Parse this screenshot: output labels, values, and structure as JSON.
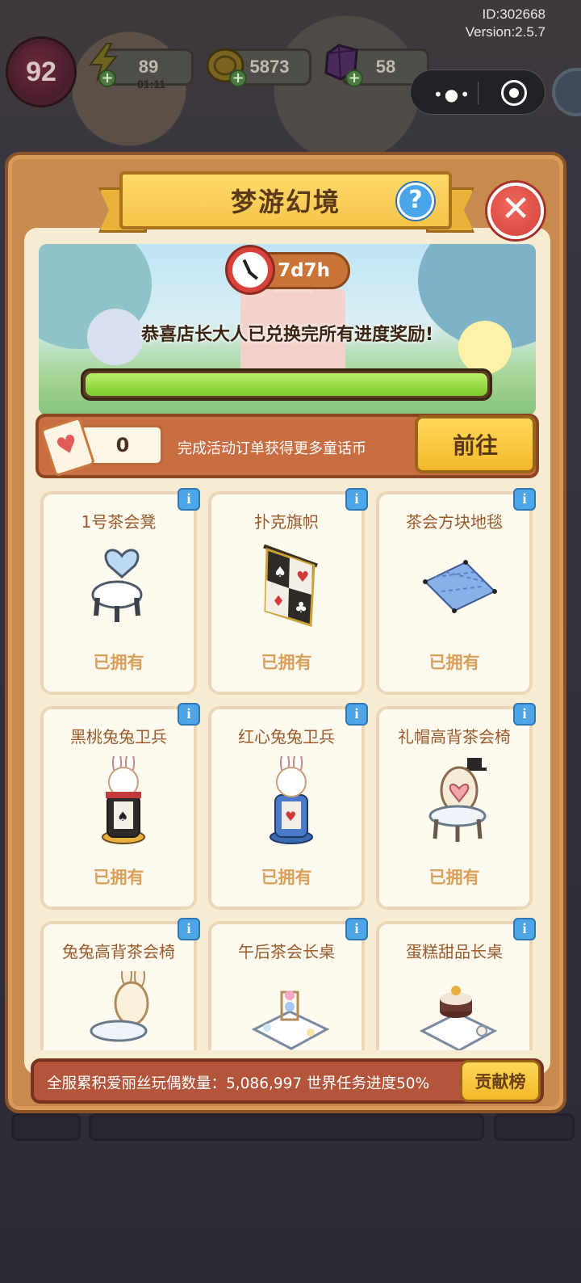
{
  "header": {
    "id_text": "ID:302668",
    "version_text": "Version:2.5.7"
  },
  "hud": {
    "level": "92",
    "energy": "89",
    "energy_timer": "01:11",
    "coins": "5873",
    "gems": "58",
    "plus_symbol": "+"
  },
  "mini_program_capsule": {
    "more_icon": "more-dots-icon",
    "close_icon": "target-icon"
  },
  "panel": {
    "title": "梦游幻境",
    "help_symbol": "?",
    "close_symbol": "✕",
    "countdown": "7d7h",
    "congrats_message": "恭喜店长大人已兑换完所有进度奖励!",
    "progress": 1.0
  },
  "currency": {
    "count": "0",
    "hint": "完成活动订单获得更多童话币",
    "goto_label": "前往",
    "card_symbol": "♥"
  },
  "items": [
    {
      "name": "1号茶会凳",
      "status": "已拥有",
      "art": "heart-stool"
    },
    {
      "name": "扑克旗帜",
      "status": "已拥有",
      "art": "poker-banner"
    },
    {
      "name": "茶会方块地毯",
      "status": "已拥有",
      "art": "checker-rug"
    },
    {
      "name": "黑桃兔兔卫兵",
      "status": "已拥有",
      "art": "spade-bunny-guard"
    },
    {
      "name": "红心兔兔卫兵",
      "status": "已拥有",
      "art": "heart-bunny-guard"
    },
    {
      "name": "礼帽高背茶会椅",
      "status": "已拥有",
      "art": "top-hat-chair"
    },
    {
      "name": "兔兔高背茶会椅",
      "status": "",
      "art": "bunny-chair"
    },
    {
      "name": "午后茶会长桌",
      "status": "",
      "art": "tea-table"
    },
    {
      "name": "蛋糕甜品长桌",
      "status": "",
      "art": "cake-table"
    }
  ],
  "info_symbol": "i",
  "footer": {
    "stats_text": "全服累积爱丽丝玩偶数量：5,086,997  世界任务进度50%",
    "rank_label": "贡献榜"
  },
  "colors": {
    "panel_frame": "#c98a4e",
    "panel_inner": "#f7ebd2",
    "title_banner": "#f5c54a",
    "close_red": "#d23f38",
    "progress_green": "#7ccc2e",
    "item_label": "#9a5a2a",
    "owned_label": "#d9a05a"
  }
}
